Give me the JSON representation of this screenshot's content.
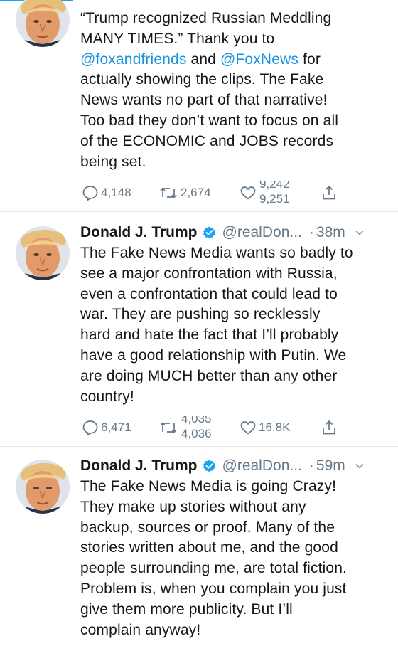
{
  "tweets": [
    {
      "lines": [
        "“Trump recognized Russian Meddling",
        "MANY TIMES.” Thank you to",
        null,
        "actually showing the clips. The Fake",
        "News wants no part of that narrative!",
        "Too bad they don’t want to focus on all",
        "of the ECONOMIC and JOBS records",
        "being set."
      ],
      "mention_1": "@foxandfriends",
      "and_word": " and ",
      "mention_2": "@FoxNews",
      "for_word": " for",
      "replies": "4,148",
      "retweets": "2,674",
      "likes_clipped": "9,242",
      "likes_next": "9,251"
    },
    {
      "name": "Donald J. Trump",
      "handle": "@realDon...",
      "dot": "·",
      "time": "38m",
      "lines": [
        "The Fake News Media wants so badly to",
        "see a major confrontation with Russia,",
        "even a confrontation that could lead to",
        "war. They are pushing so recklessly",
        "hard and hate the fact that I’ll probably",
        "have a good relationship with Putin. We",
        "are doing MUCH better than any other",
        "country!"
      ],
      "replies": "6,471",
      "retweets_clipped": "4,035",
      "retweets_next": "4,036",
      "likes": "16.8K"
    },
    {
      "name": "Donald J. Trump",
      "handle": "@realDon...",
      "dot": "·",
      "time": "59m",
      "lines": [
        "The Fake News Media is going Crazy!",
        "They make up stories without any",
        "backup, sources or proof. Many of the",
        "stories written about me, and the good",
        "people surrounding me, are total fiction.",
        "Problem is, when you complain you just",
        "give them more publicity. But I’ll",
        "complain anyway!"
      ]
    }
  ],
  "colors": {
    "text": "#14171a",
    "secondary": "#657786",
    "link": "#1b95e0",
    "verified": "#1da1f2",
    "divider": "#e1e8ed"
  },
  "icons": [
    "reply-icon",
    "retweet-icon",
    "like-icon",
    "share-icon",
    "verified-badge-icon",
    "chevron-down-icon"
  ]
}
